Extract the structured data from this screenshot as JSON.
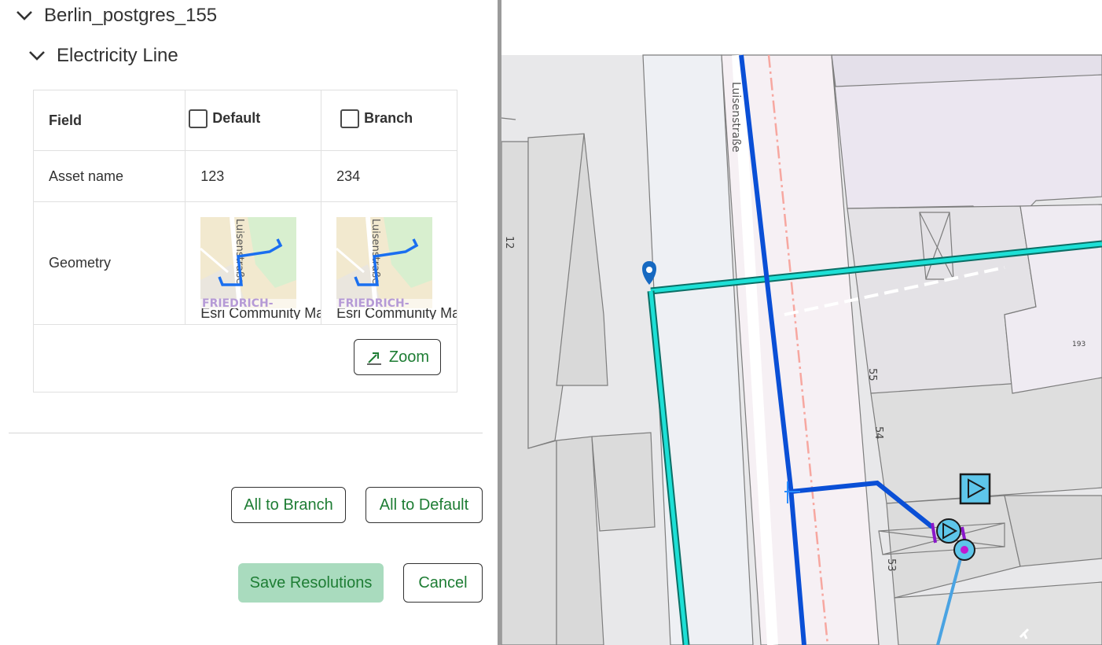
{
  "tree": {
    "root_label": "Berlin_postgres_155",
    "layer_label": "Electricity Line"
  },
  "table": {
    "header_field": "Field",
    "header_default": "Default",
    "header_branch": "Branch",
    "rows": [
      {
        "field": "Asset name",
        "default": "123",
        "branch": "234"
      },
      {
        "field": "Geometry",
        "default_caption": "Esri Community Maps",
        "branch_caption": "Esri Community Maps"
      }
    ],
    "thumb_street": "Luisenstraße",
    "thumb_district": "FRIEDRICH-"
  },
  "zoom_label": "Zoom",
  "actions": {
    "all_to_branch": "All to Branch",
    "all_to_default": "All to Default",
    "save": "Save Resolutions",
    "cancel": "Cancel"
  },
  "map": {
    "street_label": "Luisenstraße",
    "house_numbers": [
      "12",
      "55",
      "54",
      "53",
      "193"
    ]
  },
  "colors": {
    "accent_green": "#1e7d34",
    "save_bg": "#a9dbbe",
    "line_blue": "#0a4fd6",
    "line_cyan": "#1de0d6"
  }
}
